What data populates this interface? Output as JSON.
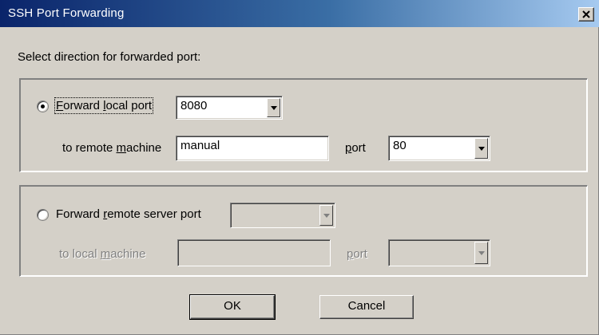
{
  "window": {
    "title": "SSH Port Forwarding"
  },
  "instruction": "Select direction for forwarded port:",
  "local_group": {
    "radio_label_pre": "",
    "radio_label_mnemonic": "F",
    "radio_label_post": "orward ",
    "radio_label_mnemonic2": "l",
    "radio_label_rest": "ocal port",
    "radio_selected": true,
    "local_port_value": "8080",
    "to_machine_pre": "to remote ",
    "to_machine_mnemonic": "m",
    "to_machine_post": "achine",
    "remote_machine_value": "manual",
    "port_label_mnemonic": "p",
    "port_label_post": "ort",
    "remote_port_value": "80"
  },
  "remote_group": {
    "radio_label_pre": "Forward ",
    "radio_label_mnemonic": "r",
    "radio_label_post": "emote server port",
    "radio_selected": false,
    "server_port_value": "",
    "to_machine_pre": "to local ",
    "to_machine_mnemonic": "m",
    "to_machine_post": "achine",
    "local_machine_value": "",
    "port_label_mnemonic": "p",
    "port_label_post": "ort",
    "local_port_value": ""
  },
  "buttons": {
    "ok": "OK",
    "cancel": "Cancel"
  },
  "icons": {
    "close": "close-icon",
    "dropdown": "chevron-down-icon"
  }
}
